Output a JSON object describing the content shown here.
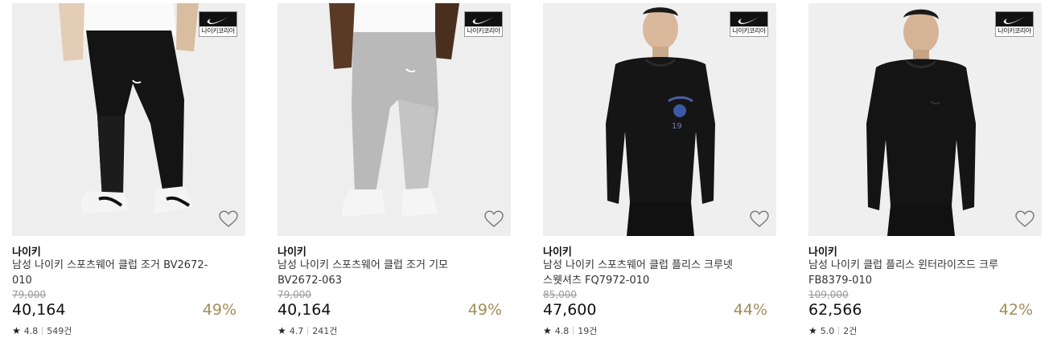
{
  "products": [
    {
      "brand": "나이키",
      "name": "남성 나이키 스포츠웨어 클럽 조거 BV2672-010",
      "original_price": "79,000",
      "price": "40,164",
      "discount": "49%",
      "rating": "4.8",
      "reviews": "549건",
      "badge": "나이키코리아",
      "image": "black-jogger-pants",
      "bg": "#efeeee"
    },
    {
      "brand": "나이키",
      "name": "남성 나이키 스포츠웨어 클럽 조거 기모 BV2672-063",
      "original_price": "79,000",
      "price": "40,164",
      "discount": "49%",
      "rating": "4.7",
      "reviews": "241건",
      "badge": "나이키코리아",
      "image": "grey-jogger-pants",
      "bg": "#efeeee"
    },
    {
      "brand": "나이키",
      "name": "남성 나이키 스포츠웨어 클럽 플리스 크루넷 스웻셔츠 FQ7972-010",
      "original_price": "85,000",
      "price": "47,600",
      "discount": "44%",
      "rating": "4.8",
      "reviews": "19건",
      "badge": "나이키코리아",
      "image": "black-crew-sweatshirt",
      "bg": "#efefef"
    },
    {
      "brand": "나이키",
      "name": "남성 나이키 클럽 플리스 윈터라이즈드 크루 FB8379-010",
      "original_price": "109,000",
      "price": "62,566",
      "discount": "42%",
      "rating": "5.0",
      "reviews": "2건",
      "badge": "나이키코리아",
      "image": "black-winterized-crew",
      "bg": "#efefef"
    }
  ],
  "colors": {
    "discount": "#a38d58",
    "original_price": "#999999",
    "price": "#111111"
  },
  "icons": [
    "heart-icon",
    "star-icon",
    "nike-swoosh-icon"
  ]
}
